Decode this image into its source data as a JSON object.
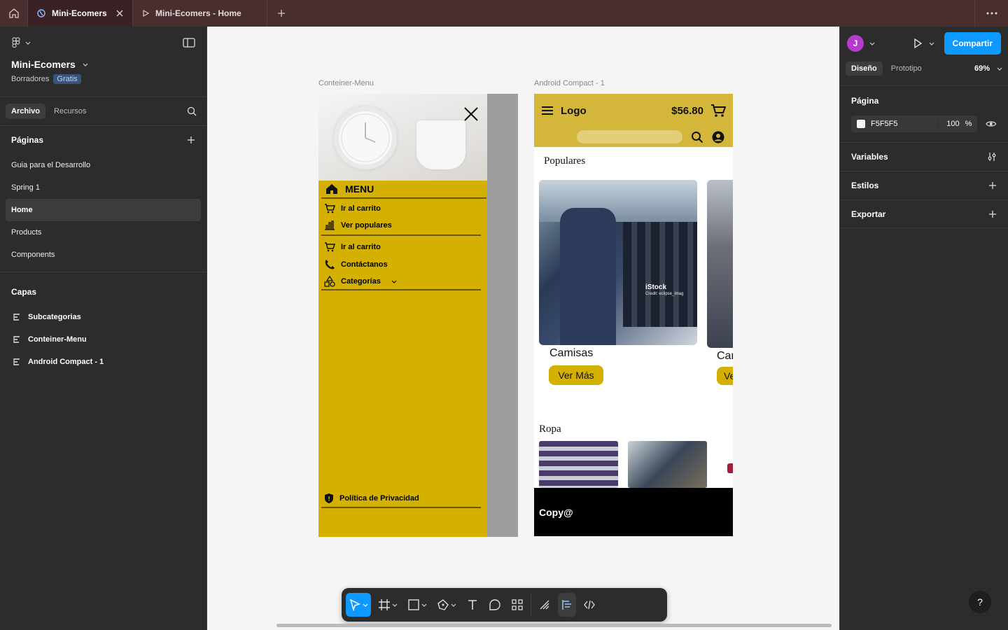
{
  "tabs": [
    {
      "label": "Mini-Ecomers"
    },
    {
      "label": "Mini-Ecomers - Home"
    }
  ],
  "left_panel": {
    "project_name": "Mini-Ecomers",
    "drafts": "Borradores",
    "plan_badge": "Gratis",
    "tab_file": "Archivo",
    "tab_assets": "Recursos",
    "pages_title": "Páginas",
    "pages": [
      "Guia para el Desarrollo",
      "Spring 1",
      "Home",
      "Products",
      "Components"
    ],
    "active_page": "Home",
    "layers_title": "Capas",
    "layers": [
      "Subcategorias",
      "Conteiner-Menu",
      "Android Compact - 1"
    ]
  },
  "right_panel": {
    "avatar_letter": "J",
    "share_label": "Compartir",
    "tab_design": "Diseño",
    "tab_prototype": "Prototipo",
    "zoom": "69%",
    "page_title": "Página",
    "page_color": "F5F5F5",
    "page_opacity": "100",
    "percent": "%",
    "variables": "Variables",
    "styles": "Estilos",
    "export": "Exportar"
  },
  "canvas": {
    "menu_frame_label": "Conteiner-Menu",
    "android_frame_label": "Android Compact - 1",
    "menu": {
      "title": "MENU",
      "items_a": [
        "Ir al carrito",
        "Ver populares"
      ],
      "items_b": [
        "Ir al carrito",
        "Contáctanos",
        "Categorías"
      ],
      "privacy": "Política de Privacidad"
    },
    "android": {
      "logo": "Logo",
      "price": "$56.80",
      "populares": "Populares",
      "card1_title": "Camisas",
      "card1_button": "Ver Más",
      "card2_title": "Car",
      "card2_button": "Ve",
      "watermark": "iStock",
      "watermark_credit": "Credit: eclipse_imag",
      "ropa": "Ropa",
      "footer": "Copy@"
    }
  },
  "colors": {
    "accent": "#0d99ff",
    "menu_yellow": "#d4b100",
    "header_yellow": "#d4b73a"
  }
}
